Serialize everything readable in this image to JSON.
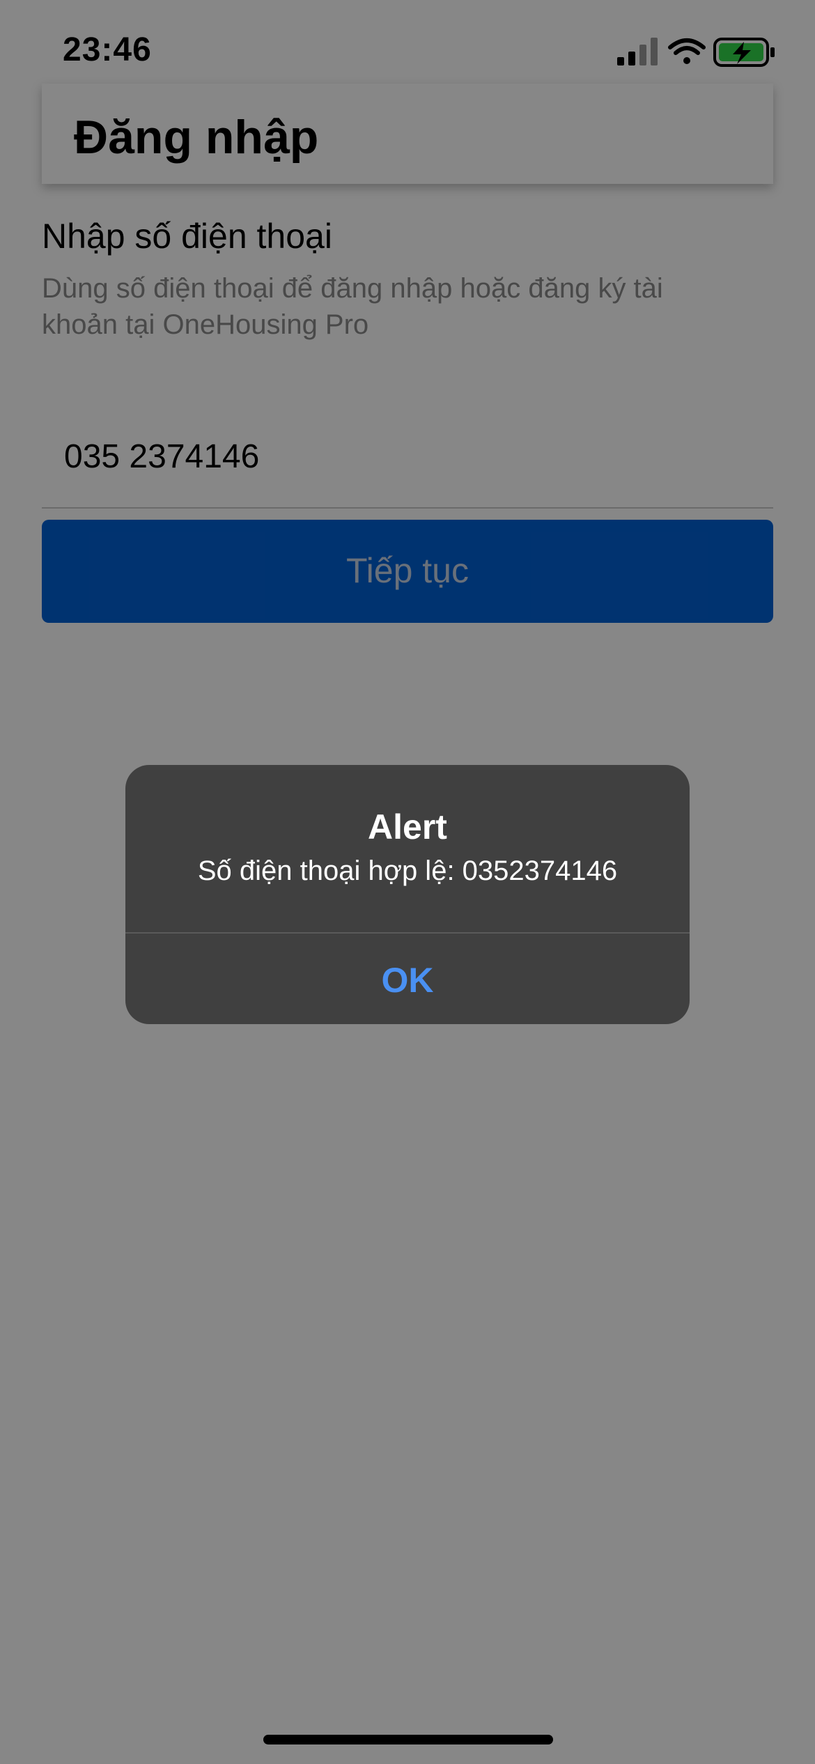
{
  "status_bar": {
    "time": "23:46",
    "icons": [
      "cellular-signal-icon",
      "wifi-icon",
      "battery-charging-icon"
    ],
    "battery_color": "#32d74b"
  },
  "header": {
    "title": "Đăng nhập"
  },
  "form": {
    "title": "Nhập số điện thoại",
    "description": "Dùng số điện thoại để đăng nhập hoặc đăng ký tài khoản tại OneHousing Pro",
    "phone_value": "035 2374146",
    "continue_label": "Tiếp tục",
    "accent_color": "#0160d4"
  },
  "alert": {
    "title": "Alert",
    "message": "Số điện thoại hợp lệ: 0352374146",
    "ok_label": "OK",
    "ok_color": "#4a90f2"
  }
}
